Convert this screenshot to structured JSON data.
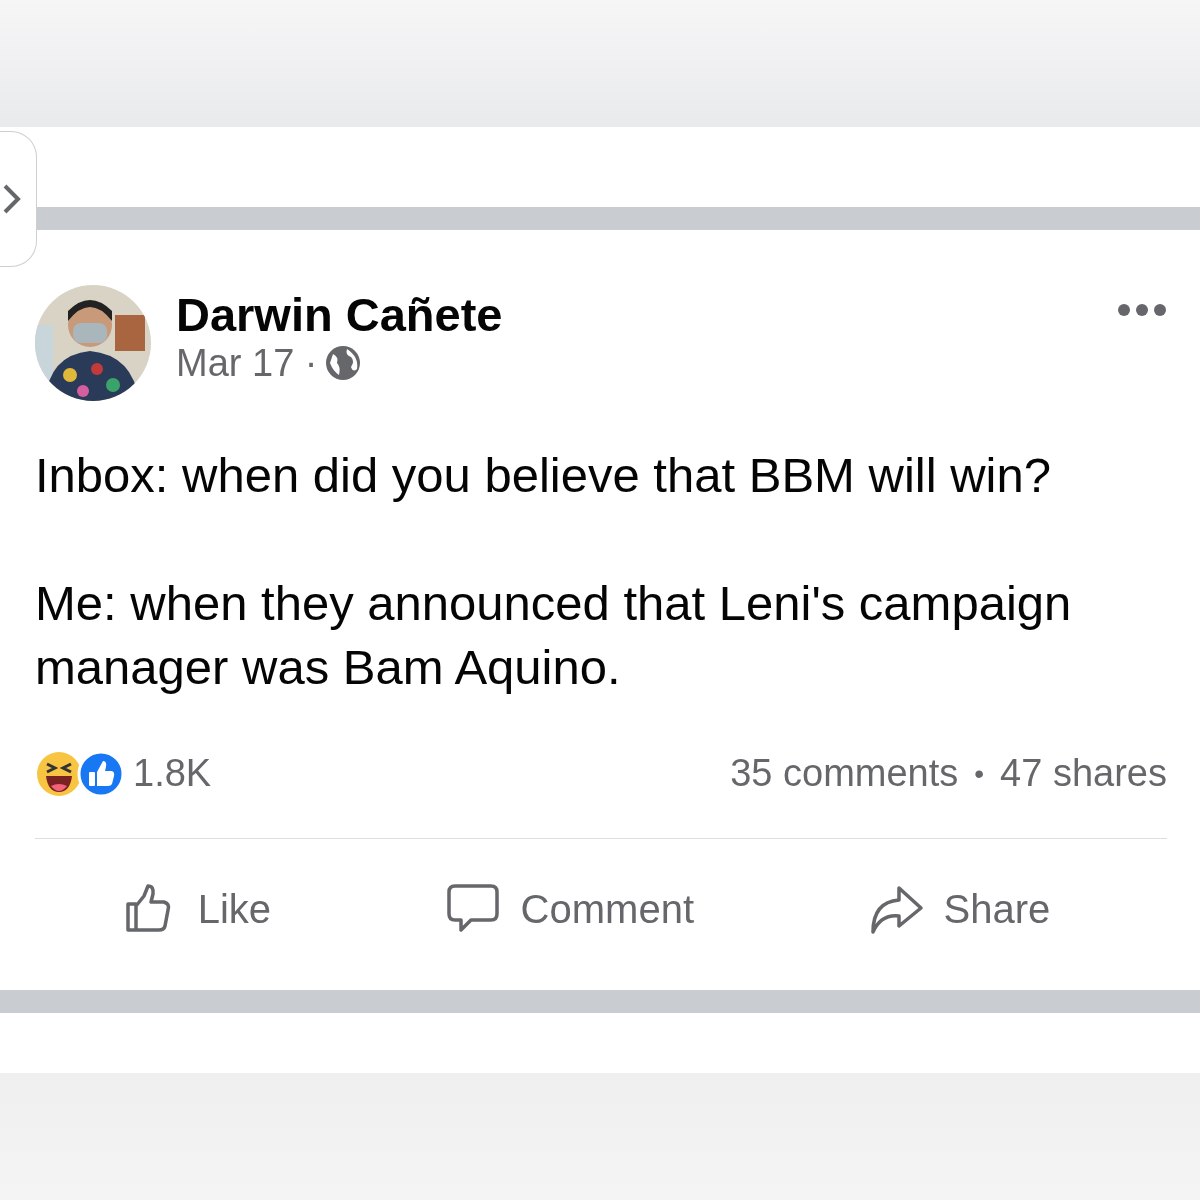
{
  "post": {
    "author": "Darwin Cañete",
    "date": "Mar 17 ·",
    "avatar": {
      "kind": "picture"
    },
    "body": [
      "Inbox: when did you believe that BBM will win?",
      "Me: when they announced that Leni's campaign manager was Bam Aquino."
    ],
    "reactions_count": "1.8K",
    "comments": "35 comments",
    "separator": "•",
    "shares": "47 shares",
    "actions": [
      {
        "kind": "like",
        "label": "Like"
      },
      {
        "kind": "comment",
        "label": "Comment"
      },
      {
        "kind": "share",
        "label": "Share"
      }
    ]
  }
}
